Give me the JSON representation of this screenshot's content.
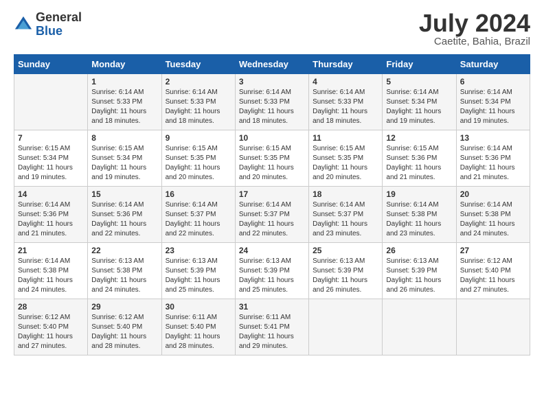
{
  "header": {
    "logo_general": "General",
    "logo_blue": "Blue",
    "month_title": "July 2024",
    "location": "Caetite, Bahia, Brazil"
  },
  "weekdays": [
    "Sunday",
    "Monday",
    "Tuesday",
    "Wednesday",
    "Thursday",
    "Friday",
    "Saturday"
  ],
  "weeks": [
    [
      {
        "day": "",
        "sunrise": "",
        "sunset": "",
        "daylight": ""
      },
      {
        "day": "1",
        "sunrise": "Sunrise: 6:14 AM",
        "sunset": "Sunset: 5:33 PM",
        "daylight": "Daylight: 11 hours and 18 minutes."
      },
      {
        "day": "2",
        "sunrise": "Sunrise: 6:14 AM",
        "sunset": "Sunset: 5:33 PM",
        "daylight": "Daylight: 11 hours and 18 minutes."
      },
      {
        "day": "3",
        "sunrise": "Sunrise: 6:14 AM",
        "sunset": "Sunset: 5:33 PM",
        "daylight": "Daylight: 11 hours and 18 minutes."
      },
      {
        "day": "4",
        "sunrise": "Sunrise: 6:14 AM",
        "sunset": "Sunset: 5:33 PM",
        "daylight": "Daylight: 11 hours and 18 minutes."
      },
      {
        "day": "5",
        "sunrise": "Sunrise: 6:14 AM",
        "sunset": "Sunset: 5:34 PM",
        "daylight": "Daylight: 11 hours and 19 minutes."
      },
      {
        "day": "6",
        "sunrise": "Sunrise: 6:14 AM",
        "sunset": "Sunset: 5:34 PM",
        "daylight": "Daylight: 11 hours and 19 minutes."
      }
    ],
    [
      {
        "day": "7",
        "sunrise": "Sunrise: 6:15 AM",
        "sunset": "Sunset: 5:34 PM",
        "daylight": "Daylight: 11 hours and 19 minutes."
      },
      {
        "day": "8",
        "sunrise": "Sunrise: 6:15 AM",
        "sunset": "Sunset: 5:34 PM",
        "daylight": "Daylight: 11 hours and 19 minutes."
      },
      {
        "day": "9",
        "sunrise": "Sunrise: 6:15 AM",
        "sunset": "Sunset: 5:35 PM",
        "daylight": "Daylight: 11 hours and 20 minutes."
      },
      {
        "day": "10",
        "sunrise": "Sunrise: 6:15 AM",
        "sunset": "Sunset: 5:35 PM",
        "daylight": "Daylight: 11 hours and 20 minutes."
      },
      {
        "day": "11",
        "sunrise": "Sunrise: 6:15 AM",
        "sunset": "Sunset: 5:35 PM",
        "daylight": "Daylight: 11 hours and 20 minutes."
      },
      {
        "day": "12",
        "sunrise": "Sunrise: 6:15 AM",
        "sunset": "Sunset: 5:36 PM",
        "daylight": "Daylight: 11 hours and 21 minutes."
      },
      {
        "day": "13",
        "sunrise": "Sunrise: 6:14 AM",
        "sunset": "Sunset: 5:36 PM",
        "daylight": "Daylight: 11 hours and 21 minutes."
      }
    ],
    [
      {
        "day": "14",
        "sunrise": "Sunrise: 6:14 AM",
        "sunset": "Sunset: 5:36 PM",
        "daylight": "Daylight: 11 hours and 21 minutes."
      },
      {
        "day": "15",
        "sunrise": "Sunrise: 6:14 AM",
        "sunset": "Sunset: 5:36 PM",
        "daylight": "Daylight: 11 hours and 22 minutes."
      },
      {
        "day": "16",
        "sunrise": "Sunrise: 6:14 AM",
        "sunset": "Sunset: 5:37 PM",
        "daylight": "Daylight: 11 hours and 22 minutes."
      },
      {
        "day": "17",
        "sunrise": "Sunrise: 6:14 AM",
        "sunset": "Sunset: 5:37 PM",
        "daylight": "Daylight: 11 hours and 22 minutes."
      },
      {
        "day": "18",
        "sunrise": "Sunrise: 6:14 AM",
        "sunset": "Sunset: 5:37 PM",
        "daylight": "Daylight: 11 hours and 23 minutes."
      },
      {
        "day": "19",
        "sunrise": "Sunrise: 6:14 AM",
        "sunset": "Sunset: 5:38 PM",
        "daylight": "Daylight: 11 hours and 23 minutes."
      },
      {
        "day": "20",
        "sunrise": "Sunrise: 6:14 AM",
        "sunset": "Sunset: 5:38 PM",
        "daylight": "Daylight: 11 hours and 24 minutes."
      }
    ],
    [
      {
        "day": "21",
        "sunrise": "Sunrise: 6:14 AM",
        "sunset": "Sunset: 5:38 PM",
        "daylight": "Daylight: 11 hours and 24 minutes."
      },
      {
        "day": "22",
        "sunrise": "Sunrise: 6:13 AM",
        "sunset": "Sunset: 5:38 PM",
        "daylight": "Daylight: 11 hours and 24 minutes."
      },
      {
        "day": "23",
        "sunrise": "Sunrise: 6:13 AM",
        "sunset": "Sunset: 5:39 PM",
        "daylight": "Daylight: 11 hours and 25 minutes."
      },
      {
        "day": "24",
        "sunrise": "Sunrise: 6:13 AM",
        "sunset": "Sunset: 5:39 PM",
        "daylight": "Daylight: 11 hours and 25 minutes."
      },
      {
        "day": "25",
        "sunrise": "Sunrise: 6:13 AM",
        "sunset": "Sunset: 5:39 PM",
        "daylight": "Daylight: 11 hours and 26 minutes."
      },
      {
        "day": "26",
        "sunrise": "Sunrise: 6:13 AM",
        "sunset": "Sunset: 5:39 PM",
        "daylight": "Daylight: 11 hours and 26 minutes."
      },
      {
        "day": "27",
        "sunrise": "Sunrise: 6:12 AM",
        "sunset": "Sunset: 5:40 PM",
        "daylight": "Daylight: 11 hours and 27 minutes."
      }
    ],
    [
      {
        "day": "28",
        "sunrise": "Sunrise: 6:12 AM",
        "sunset": "Sunset: 5:40 PM",
        "daylight": "Daylight: 11 hours and 27 minutes."
      },
      {
        "day": "29",
        "sunrise": "Sunrise: 6:12 AM",
        "sunset": "Sunset: 5:40 PM",
        "daylight": "Daylight: 11 hours and 28 minutes."
      },
      {
        "day": "30",
        "sunrise": "Sunrise: 6:11 AM",
        "sunset": "Sunset: 5:40 PM",
        "daylight": "Daylight: 11 hours and 28 minutes."
      },
      {
        "day": "31",
        "sunrise": "Sunrise: 6:11 AM",
        "sunset": "Sunset: 5:41 PM",
        "daylight": "Daylight: 11 hours and 29 minutes."
      },
      {
        "day": "",
        "sunrise": "",
        "sunset": "",
        "daylight": ""
      },
      {
        "day": "",
        "sunrise": "",
        "sunset": "",
        "daylight": ""
      },
      {
        "day": "",
        "sunrise": "",
        "sunset": "",
        "daylight": ""
      }
    ]
  ]
}
